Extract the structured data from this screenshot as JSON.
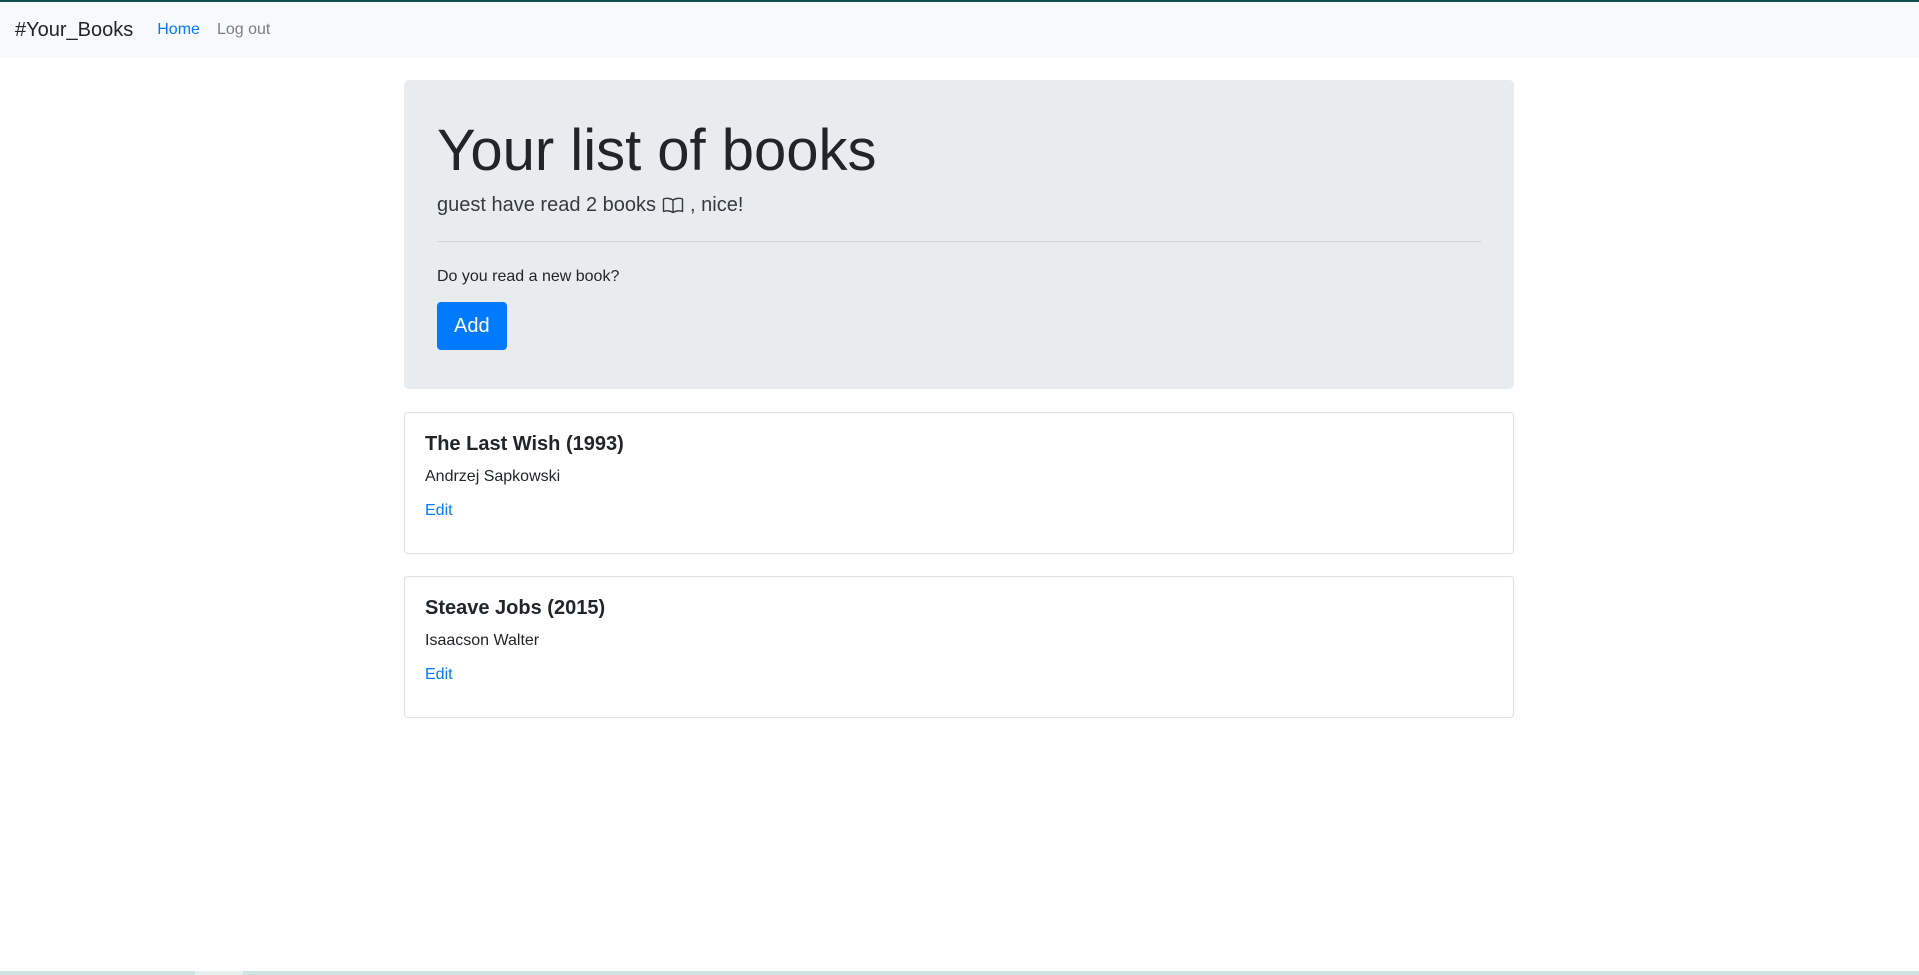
{
  "navbar": {
    "brand": "#Your_Books",
    "links": [
      {
        "label": "Home",
        "active": true
      },
      {
        "label": "Log out",
        "active": false
      }
    ]
  },
  "jumbotron": {
    "title": "Your list of books",
    "lead_prefix": "guest have read 2 books",
    "lead_icon": "book-open-icon",
    "lead_suffix": ", nice!",
    "prompt": "Do you read a new book?",
    "add_button": "Add"
  },
  "books": [
    {
      "title": "The Last Wish (1993)",
      "author": "Andrzej Sapkowski",
      "edit_label": "Edit"
    },
    {
      "title": "Steave Jobs (2015)",
      "author": "Isaacson Walter",
      "edit_label": "Edit"
    }
  ],
  "colors": {
    "primary": "#007bff",
    "navbar_bg": "#f8f9fa",
    "jumbotron_bg": "#e9ecef",
    "accent_top": "#0f4f54"
  }
}
